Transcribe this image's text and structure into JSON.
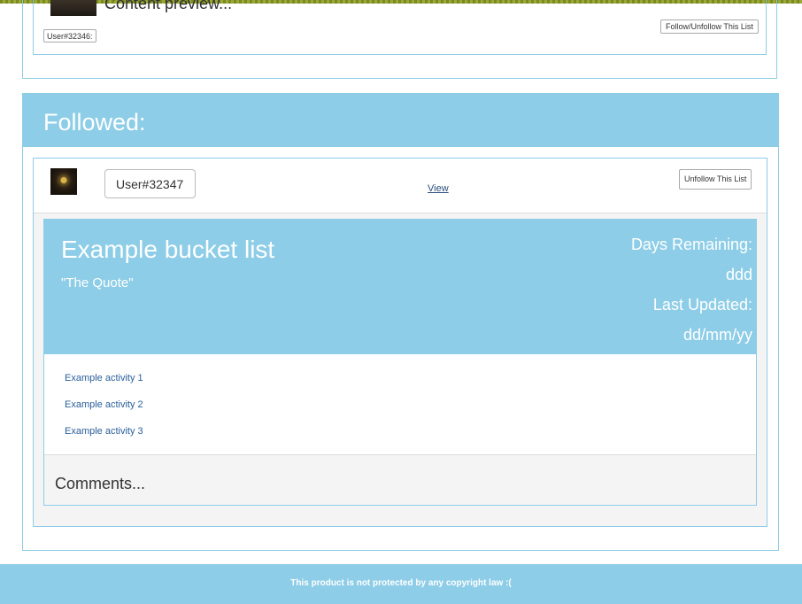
{
  "previous_list": {
    "content_preview": "Content preview...",
    "user": "User#32346:",
    "follow_button": "Follow/Unfollow This List"
  },
  "followed": {
    "title": "Followed:",
    "card": {
      "user_value": "User#32347:",
      "view_link": "View",
      "unfollow_button": "Unfollow This List",
      "bucket_list": {
        "title": "Example bucket list",
        "quote": "\"The Quote\"",
        "days_remaining_label": "Days Remaining:",
        "days_remaining_value": "ddd",
        "last_updated_label": "Last Updated:",
        "last_updated_value": "dd/mm/yy",
        "activities": [
          "Example activity 1",
          "Example activity 2",
          "Example activity 3"
        ],
        "comments_label": "Comments..."
      }
    }
  },
  "footer": {
    "text": "This product is not protected by any copyright law :("
  },
  "colors": {
    "accent": "#8dcde7",
    "border": "#8ecde6",
    "link": "#2a5f9a"
  }
}
